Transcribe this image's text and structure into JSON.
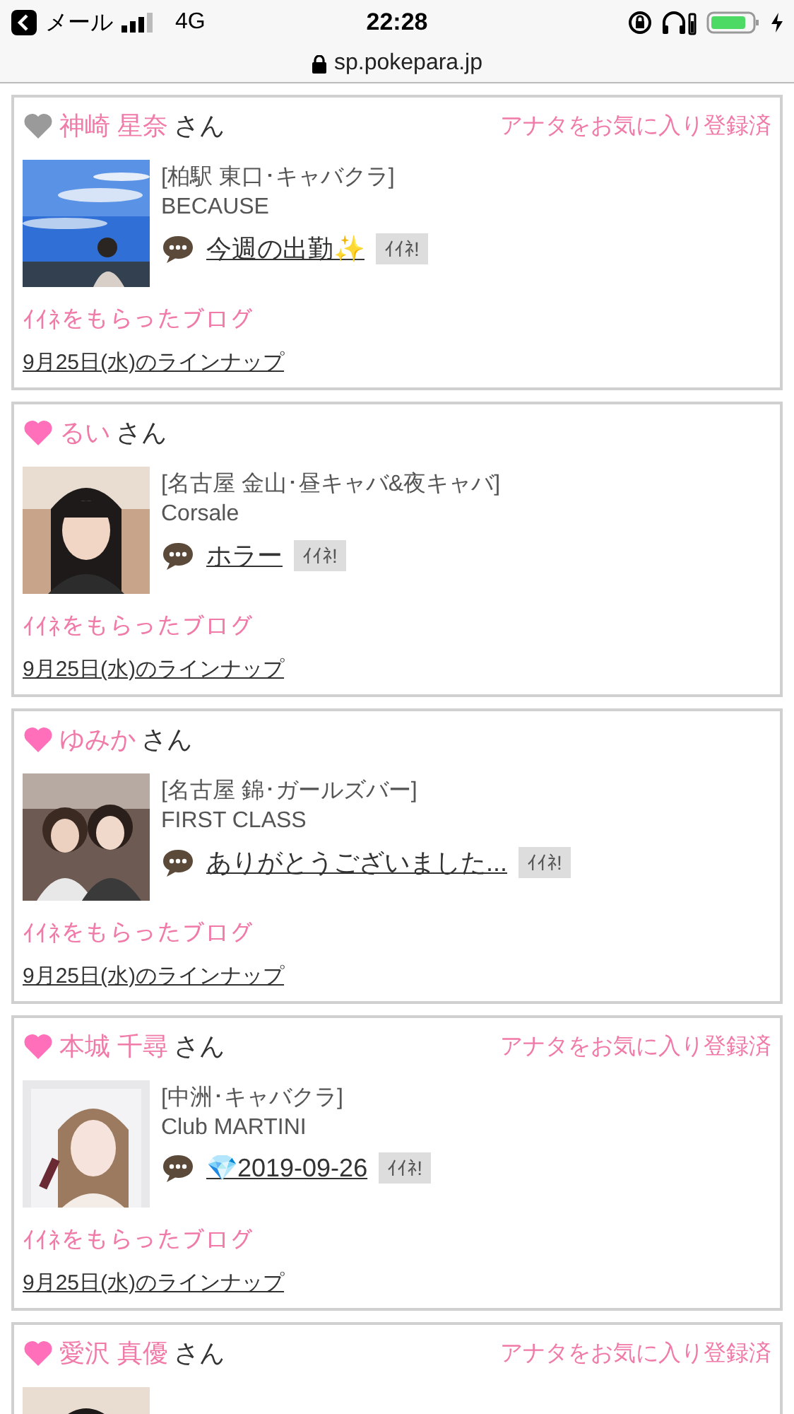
{
  "status_bar": {
    "back_label": "メール",
    "network": "4G",
    "time": "22:28"
  },
  "url_bar": {
    "url": "sp.pokepara.jp"
  },
  "cards": [
    {
      "name": "神崎 星奈",
      "suffix": "さん",
      "liked": false,
      "favorite_note": "アナタをお気に入り登録済",
      "area": "[柏駅 東口･キャバクラ]",
      "shop": "BECAUSE",
      "blog_title": "今週の出勤✨",
      "iine": "ｲｲﾈ!",
      "received_label": "ｲｲﾈをもらったブログ",
      "lineup": "9月25日(水)のラインナップ"
    },
    {
      "name": "るい",
      "suffix": "さん",
      "liked": true,
      "area": "[名古屋 金山･昼キャバ&夜キャバ]",
      "shop": "Corsale",
      "blog_title": "ホラー",
      "iine": "ｲｲﾈ!",
      "received_label": "ｲｲﾈをもらったブログ",
      "lineup": "9月25日(水)のラインナップ"
    },
    {
      "name": "ゆみか",
      "suffix": "さん",
      "liked": true,
      "area": "[名古屋 錦･ガールズバー]",
      "shop": "FIRST CLASS",
      "blog_title": "ありがとうございました...",
      "iine": "ｲｲﾈ!",
      "received_label": "ｲｲﾈをもらったブログ",
      "lineup": "9月25日(水)のラインナップ"
    },
    {
      "name": "本城 千尋",
      "suffix": "さん",
      "liked": true,
      "favorite_note": "アナタをお気に入り登録済",
      "area": "[中洲･キャバクラ]",
      "shop": "Club MARTINI",
      "blog_title": "💎2019-09-26",
      "iine": "ｲｲﾈ!",
      "received_label": "ｲｲﾈをもらったブログ",
      "lineup": "9月25日(水)のラインナップ"
    },
    {
      "name": "愛沢 真優",
      "suffix": "さん",
      "liked": true,
      "favorite_note": "アナタをお気に入り登録済"
    }
  ]
}
